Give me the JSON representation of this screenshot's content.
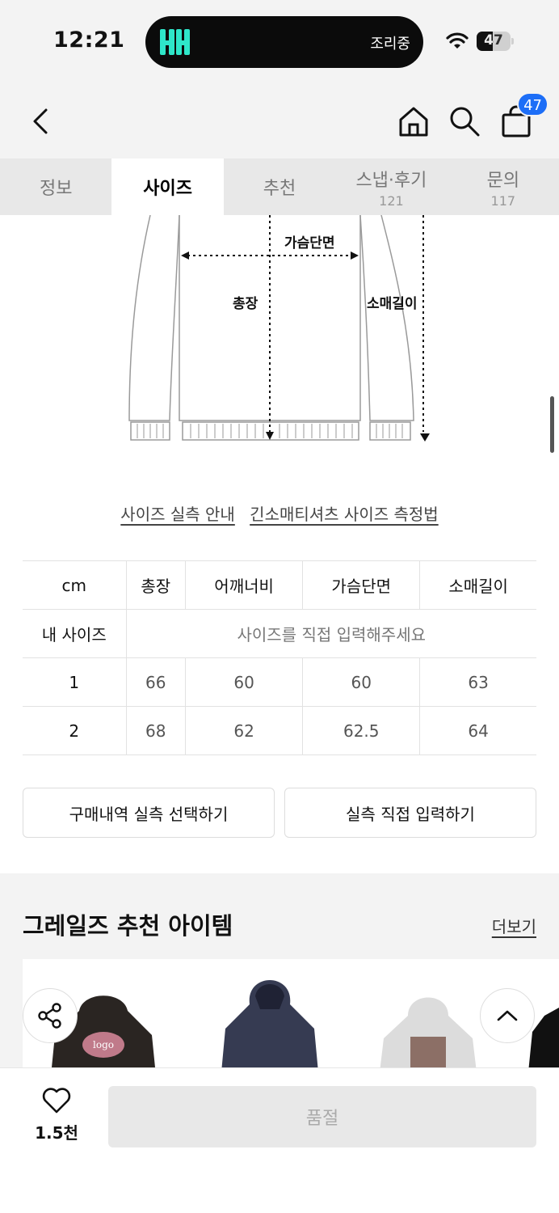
{
  "status_bar": {
    "time": "12:21",
    "activity_text": "조리중",
    "battery": "47",
    "battery_level": 0.47
  },
  "header": {
    "cart_count": "47",
    "icons": [
      "back-icon",
      "home-icon",
      "search-icon",
      "cart-icon"
    ]
  },
  "tabs": [
    {
      "label": "정보",
      "count": ""
    },
    {
      "label": "사이즈",
      "count": ""
    },
    {
      "label": "추천",
      "count": ""
    },
    {
      "label": "스냅·후기",
      "count": "121"
    },
    {
      "label": "문의",
      "count": "117"
    }
  ],
  "active_tab": "사이즈",
  "diagram": {
    "chest": "가슴단면",
    "length": "총장",
    "sleeve": "소매길이"
  },
  "links": {
    "guide": "사이즈 실측 안내",
    "method": "긴소매티셔츠 사이즈 측정법"
  },
  "size_table": {
    "unit": "cm",
    "columns": [
      "총장",
      "어깨너비",
      "가슴단면",
      "소매길이"
    ],
    "my_size_label": "내 사이즈",
    "my_size_placeholder": "사이즈를 직접 입력해주세요",
    "rows": [
      {
        "size": "1",
        "values": [
          "66",
          "60",
          "60",
          "63"
        ]
      },
      {
        "size": "2",
        "values": [
          "68",
          "62",
          "62.5",
          "64"
        ]
      }
    ]
  },
  "actions": {
    "purchase_history": "구매내역 실측 선택하기",
    "direct_input": "실측 직접 입력하기"
  },
  "recommend": {
    "title": "그레일즈 추천 아이템",
    "more": "더보기"
  },
  "bottom": {
    "like_count": "1.5천",
    "buy_label": "품절"
  },
  "colors": {
    "accent": "#1d6ef7",
    "island_logo": "#2ee6c9",
    "background_gray": "#f3f3f3"
  }
}
